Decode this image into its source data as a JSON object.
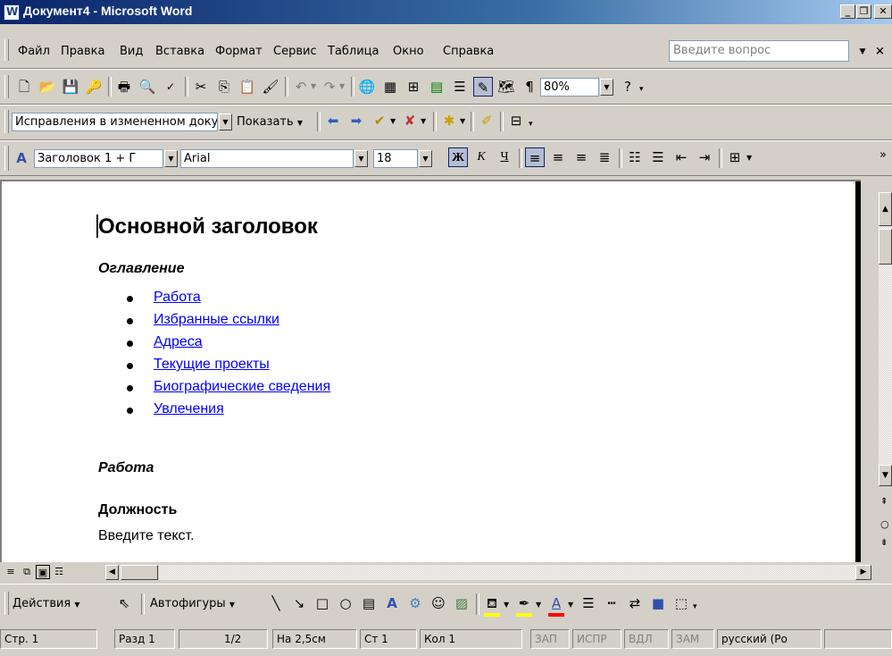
{
  "window": {
    "title": "Документ4 - Microsoft Word"
  },
  "menu": {
    "items": [
      "Файл",
      "Правка",
      "Вид",
      "Вставка",
      "Формат",
      "Сервис",
      "Таблица",
      "Окно",
      "Справка"
    ],
    "ask_placeholder": "Введите вопрос"
  },
  "standard_toolbar": {
    "zoom": "80%"
  },
  "review_toolbar": {
    "display_mode": "Исправления в измененном докумен",
    "show_label": "Показать"
  },
  "format_toolbar": {
    "style": "Заголовок 1 + Г",
    "font": "Arial",
    "size": "18",
    "bold": "Ж",
    "italic": "К",
    "underline": "Ч"
  },
  "document": {
    "heading": "Основной заголовок",
    "toc_title": "Оглавление",
    "toc_items": [
      "Работа",
      "Избранные ссылки",
      "Адреса",
      "Текущие проекты",
      "Биографические сведения",
      "Увлечения"
    ],
    "section_title": "Работа",
    "field_label": "Должность",
    "field_text": "Введите текст."
  },
  "drawing_toolbar": {
    "actions_label": "Действия",
    "autoshapes_label": "Автофигуры",
    "fill_color": "#ffff00",
    "line_color": "#ffff00",
    "font_color": "#ff0000"
  },
  "status_bar": {
    "page": "Стр. 1",
    "section": "Разд 1",
    "pages": "1/2",
    "at": "На 2,5см",
    "line": "Ст 1",
    "col": "Кол 1",
    "rec": "ЗАП",
    "trk": "ИСПР",
    "ext": "ВДЛ",
    "ovr": "ЗАМ",
    "language": "русский (Ро"
  },
  "colors": {
    "titlebar": "#0a246a",
    "link": "#0000ff",
    "chrome": "#d4d0c8"
  }
}
